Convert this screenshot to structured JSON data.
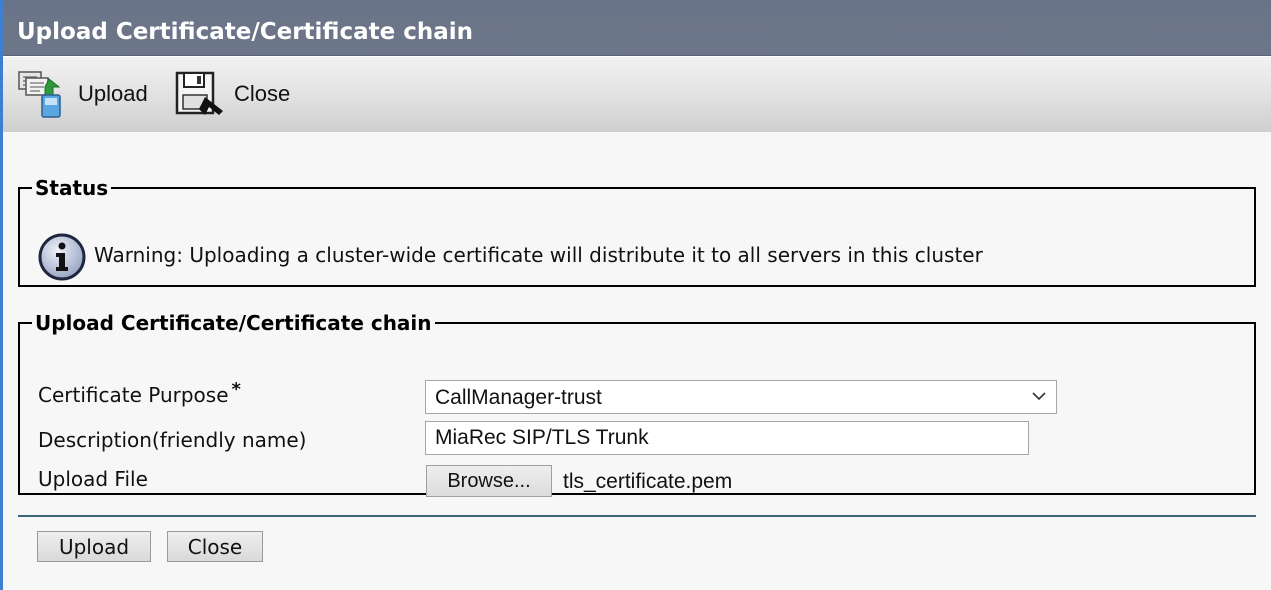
{
  "window": {
    "title": "Upload Certificate/Certificate chain"
  },
  "toolbar": {
    "upload_label": "Upload",
    "upload_icon": "upload-certificate-icon",
    "close_label": "Close",
    "close_icon": "close-save-icon"
  },
  "status": {
    "legend": "Status",
    "icon": "info-icon",
    "message": "Warning: Uploading a cluster-wide certificate will distribute it to all servers in this cluster"
  },
  "form": {
    "legend": "Upload Certificate/Certificate chain",
    "purpose_label": "Certificate Purpose",
    "required_marker": "*",
    "purpose_value": "CallManager-trust",
    "description_label": "Description(friendly name)",
    "description_value": "MiaRec SIP/TLS Trunk",
    "file_label": "Upload File",
    "browse_label": "Browse...",
    "file_name": "tls_certificate.pem"
  },
  "footer": {
    "upload_label": "Upload",
    "close_label": "Close"
  },
  "colors": {
    "title_bar": "#6a7488",
    "accent_edge": "#3d7fd1",
    "divider": "#3f6673"
  }
}
